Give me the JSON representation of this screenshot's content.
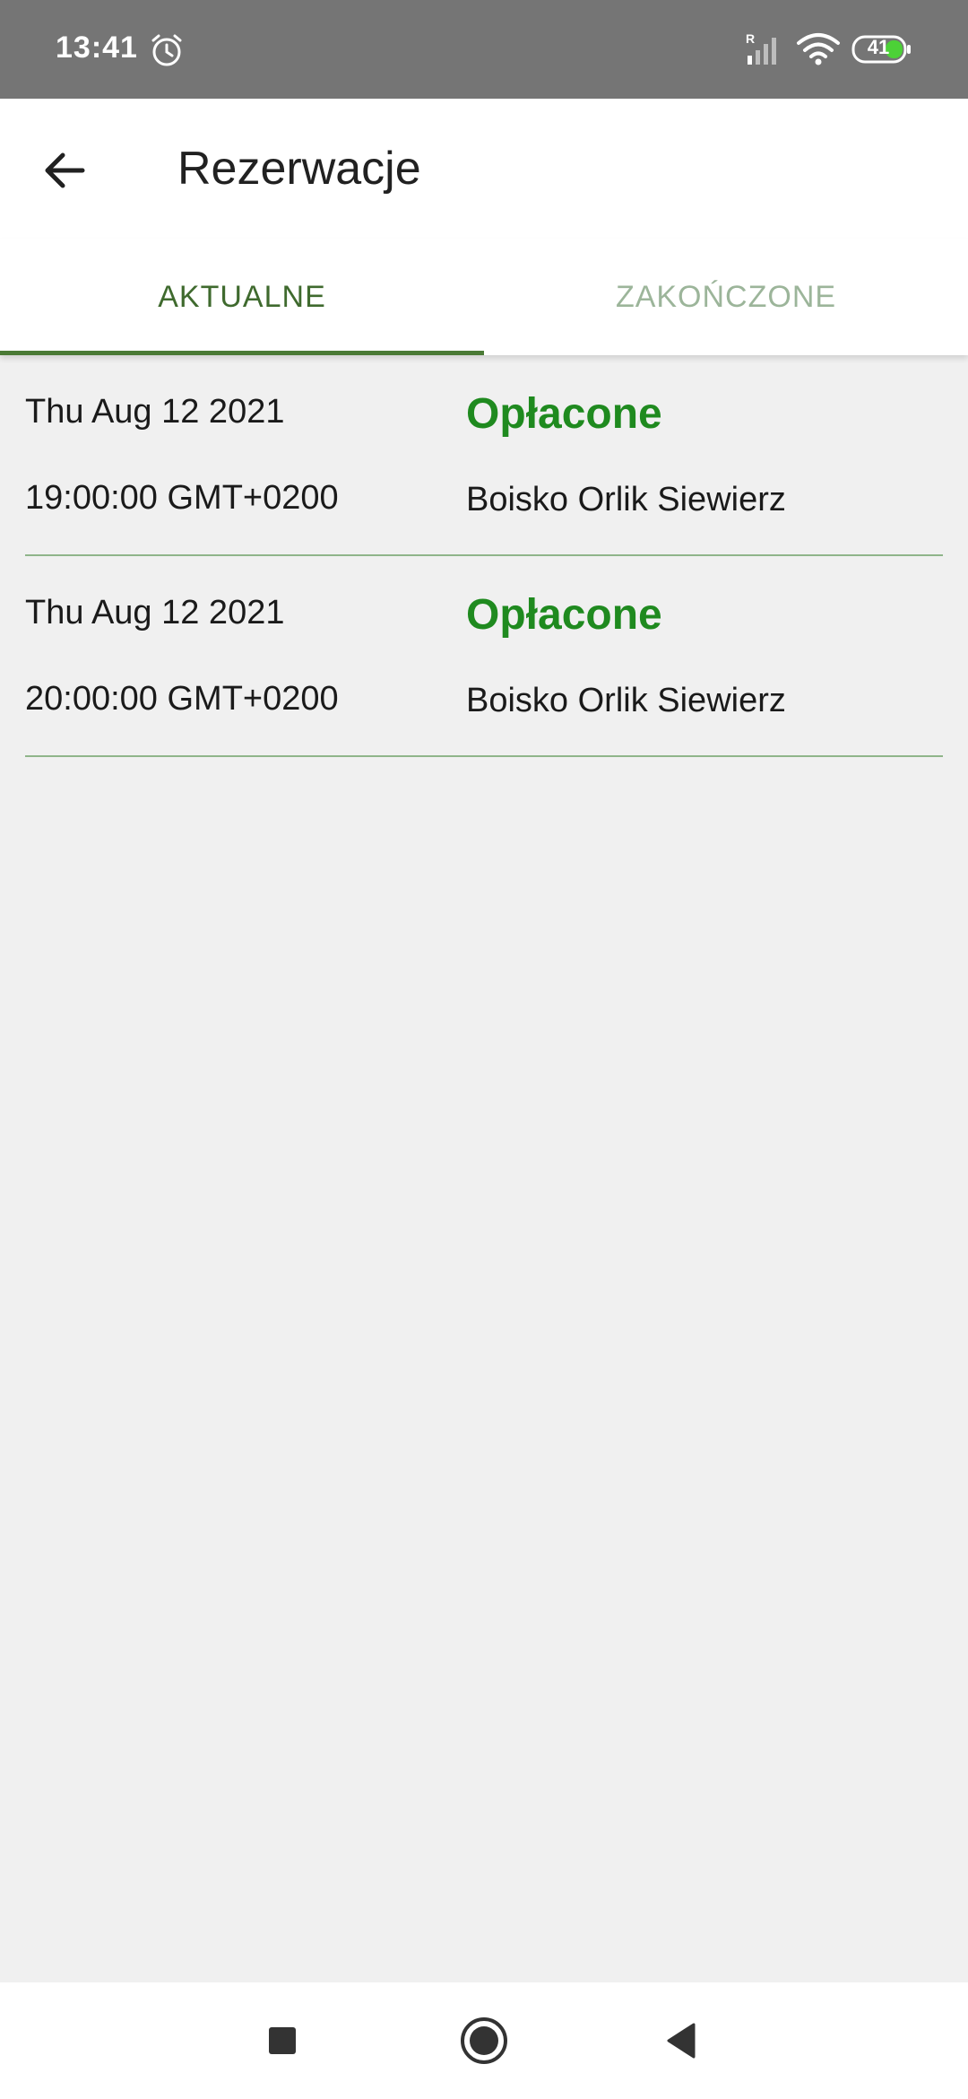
{
  "status_bar": {
    "time": "13:41",
    "battery": "41",
    "icons": [
      "alarm-icon",
      "signal-icon",
      "wifi-icon",
      "battery-icon"
    ]
  },
  "app_bar": {
    "title": "Rezerwacje",
    "back_icon": "arrow-left-icon"
  },
  "tabs": [
    {
      "label": "AKTUALNE",
      "active": true
    },
    {
      "label": "ZAKOŃCZONE",
      "active": false
    }
  ],
  "reservations": [
    {
      "date": "Thu Aug 12 2021",
      "time": "19:00:00 GMT+0200",
      "status": "Opłacone",
      "place": "Boisko Orlik Siewierz"
    },
    {
      "date": "Thu Aug 12 2021",
      "time": "20:00:00 GMT+0200",
      "status": "Opłacone",
      "place": "Boisko Orlik Siewierz"
    }
  ],
  "nav_bar": {
    "icons": [
      "recents-square-icon",
      "home-circle-icon",
      "back-triangle-icon"
    ]
  },
  "colors": {
    "accent": "#4a7a35",
    "status_paid": "#1f8a1f",
    "tab_inactive": "#9cb59a",
    "status_bar": "#757575",
    "background": "#f0f0f0"
  }
}
